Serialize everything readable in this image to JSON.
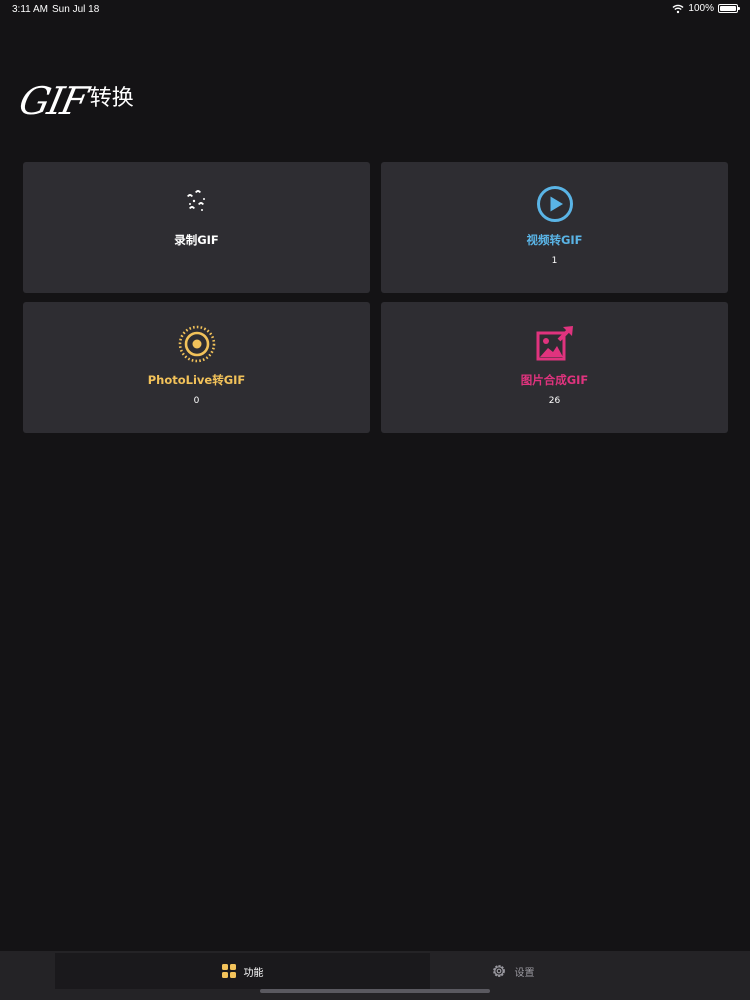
{
  "status_bar": {
    "time": "3:11 AM",
    "date": "Sun Jul 18",
    "battery": "100%"
  },
  "app": {
    "title_logo": "GIF",
    "title_text": "转换"
  },
  "cards": [
    {
      "label": "录制GIF",
      "count": "",
      "icon": "footprints-icon",
      "color": "#ffffff"
    },
    {
      "label": "视频转GIF",
      "count": "1",
      "icon": "play-circle-icon",
      "color": "#5ab4e6"
    },
    {
      "label": "PhotoLive转GIF",
      "count": "0",
      "icon": "live-photo-icon",
      "color": "#f2c25a"
    },
    {
      "label": "图片合成GIF",
      "count": "26",
      "icon": "image-compose-icon",
      "color": "#e0337e"
    }
  ],
  "tabs": [
    {
      "label": "功能",
      "icon": "grid-icon",
      "active": true,
      "color": "#f2c25a"
    },
    {
      "label": "设置",
      "icon": "gear-icon",
      "active": false,
      "color": "#9a99a0"
    }
  ]
}
